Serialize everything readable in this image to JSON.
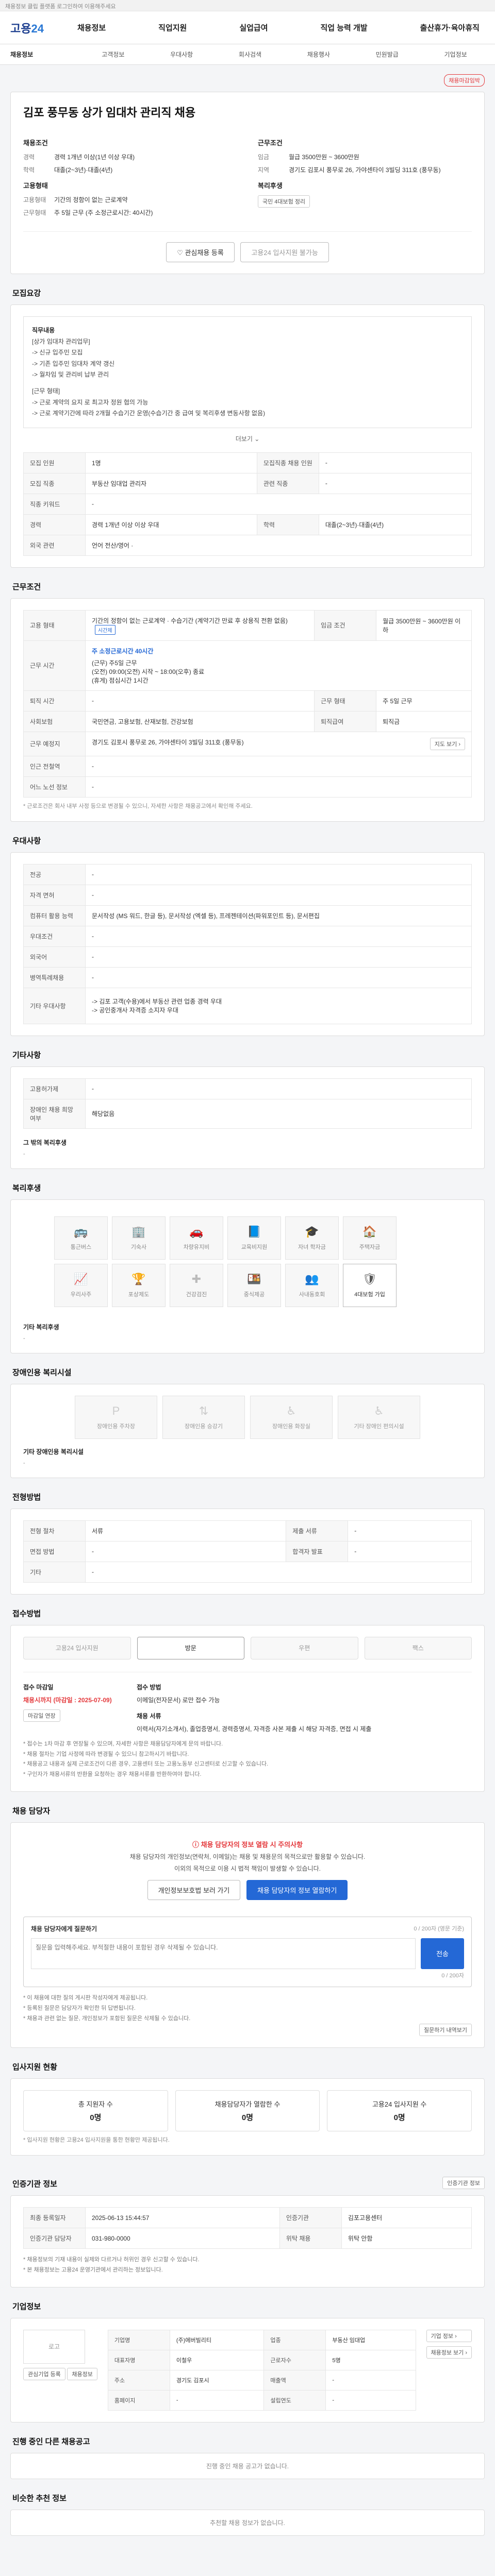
{
  "top_notice": "채용정보 클립 플랫폼 로그인하여 이용해주세요",
  "brand": {
    "name_main": "고용",
    "name_num": "24"
  },
  "gnb": [
    "채용정보",
    "직업지원",
    "실업급여",
    "직업 능력 개발",
    "출산휴가·육아휴직"
  ],
  "subnav": [
    "채용정보",
    "고객정보",
    "우대사항",
    "회사검색",
    "채용행사",
    "민원발급",
    "기업정보"
  ],
  "job": {
    "badge": "채용마감임박",
    "title": "김포 풍무동 상가 임대차 관리직 채용",
    "left_title": "채용조건",
    "left": [
      {
        "k": "경력",
        "v": "경력 1개년 이상(1년 이상 우대)"
      },
      {
        "k": "학력",
        "v": "대졸(2~3년)·대졸(4년)"
      }
    ],
    "right_title": "근무조건",
    "right": [
      {
        "k": "임금",
        "v": "월급 3500만원 ~ 3600만원"
      },
      {
        "k": "지역",
        "v": "경기도 김포시 풍무로 26, 가야센타이 3빌딩 311호 (풍무동)"
      }
    ],
    "left2_title": "고용형태",
    "left2": [
      {
        "k": "고용형태",
        "v": "기간의 정함이 없는 근로계약"
      },
      {
        "k": "근무형태",
        "v": "주 5일 근무 (주 소정근로시간: 40시간)"
      }
    ],
    "right2_title": "복리후생",
    "right2_badge": "국민 4대보험 정리",
    "btn_like": "관심채용 등록",
    "btn_share": "고용24 입사지원 불가능"
  },
  "summary": {
    "section": "모집요강",
    "box_title": "직무내용",
    "lines": [
      "[상가 임대차 관리업무]",
      "-> 신규 입주민 모집",
      "-> 기존 입주민 임대차 계약 갱신",
      "-> 월차임 및 관리비 납부 관리",
      "",
      "[근무 형태]",
      "-> 근로 계약의 요지 로 최고자 정원 협의 가능",
      "-> 근로 계약기간에 따라 2개월 수습기간 운영(수습기간 중 급여 및 복리후생 변동사항 없음)"
    ],
    "more": "더보기 ⌄"
  },
  "detail_table": [
    [
      "모집 인원",
      "1명",
      "모집직종 채용 인원",
      "-"
    ],
    [
      "모집 직종",
      "부동산 임대업 관리자",
      "관련 직종",
      "-"
    ],
    [
      "직종 키워드",
      "-",
      "",
      ""
    ],
    [
      "경력",
      "경력 1개년 이상 이상 우대",
      "학력",
      "대졸(2~3년)·대졸(4년)"
    ],
    [
      "외국 관련",
      "언어 전산/영어 ·",
      "",
      ""
    ]
  ],
  "conditions": {
    "section": "근무조건",
    "emp_type": "기간의 정함이 없는 근로계약 · 수습기간 (계약기간 만료 후 상용직 전환 없음)",
    "emp_tag": "시간제",
    "salary_label": "임금 조건",
    "salary": "월급 3500만원 ~ 3600만원 이하",
    "hours_label": "근무 시간",
    "hours_badge": "주 소정근로시간 40시간",
    "hours_lines": [
      "(근무) 주5일 근무",
      "(오전) 09:00(오전) 시작 ~ 18:00(오후) 종료",
      "(휴게) 점심시간 1시간"
    ],
    "rows": [
      [
        "퇴직 시간",
        "-",
        "근무 형태",
        "주 5일 근무"
      ],
      [
        "사회보험",
        "국민연금, 고용보험, 산재보험, 건강보험",
        "퇴직급여",
        "퇴직금"
      ],
      [
        "근무 예정지",
        "경기도 김포시 풍무로 26, 가야센타이 3빌딩 311호 (풍무동)",
        "",
        ""
      ],
      [
        "인근 전철역",
        "-",
        "",
        ""
      ],
      [
        "어느 노선 정보",
        "-",
        "",
        ""
      ]
    ],
    "map_btn": "지도 보기 ›",
    "note": "* 근로조건은 회사 내부 사정 등으로 변경될 수 있으니, 자세한 사항은 채용공고에서 확인해 주세요."
  },
  "preference": {
    "section": "우대사항",
    "rows": [
      [
        "전공",
        "-"
      ],
      [
        "자격 면허",
        "-"
      ],
      [
        "컴퓨터 활용 능력",
        "문서작성 (MS 워드, 한글 등), 문서작성 (엑셀 등), 프레젠테이션(파워포인트 등), 문서편집"
      ],
      [
        "우대조건",
        "-"
      ],
      [
        "외국어",
        "-"
      ],
      [
        "병역특례채용",
        "-"
      ],
      [
        "기타 우대사항",
        "-> 김포 고객(수용)에서 부동산 관련 업종 경력 우대\n-> 공인중개사 자격증 소지자 우대"
      ]
    ]
  },
  "other": {
    "section": "기타사항",
    "rows": [
      [
        "고용허가제",
        "-"
      ],
      [
        "장애인 채용 희망 여부",
        "해당없음"
      ]
    ],
    "etc_title": "그 밖의 복리후생",
    "etc_value": "-"
  },
  "welfare": {
    "section": "복리후생",
    "items": [
      {
        "icon": "▣",
        "label": "통근버스",
        "on": false
      },
      {
        "icon": "▣",
        "label": "기숙사",
        "on": false
      },
      {
        "icon": "▣",
        "label": "차량유지비",
        "on": false
      },
      {
        "icon": "▣",
        "label": "교육비지원",
        "on": false
      },
      {
        "icon": "▣",
        "label": "자녀 학자금",
        "on": false
      },
      {
        "icon": "▣",
        "label": "주택자금",
        "on": false
      },
      {
        "icon": "▣",
        "label": "우리사주",
        "on": false
      },
      {
        "icon": "▣",
        "label": "포상제도",
        "on": false
      },
      {
        "icon": "▣",
        "label": "건강검진",
        "on": false
      },
      {
        "icon": "▣",
        "label": "중식제공",
        "on": false
      },
      {
        "icon": "▣",
        "label": "사내동호회",
        "on": false
      },
      {
        "icon": "▣",
        "label": "4대보험 가입",
        "on": true
      }
    ],
    "etc_title": "기타 복리후생",
    "etc_value": "-"
  },
  "disability": {
    "section": "장애인용 복리시설",
    "items": [
      "장애인용 주차장",
      "장애인용 승강기",
      "장애인용 화장실",
      "기타 장애인 편의시설"
    ],
    "etc_title": "기타 장애인용 복리시설",
    "etc_value": "-"
  },
  "process": {
    "section": "전형방법",
    "rows": [
      [
        "전형 절차",
        "서류",
        "제출 서류",
        "-"
      ],
      [
        "면접 방법",
        "-",
        "합격자 발표",
        "-"
      ],
      [
        "기타",
        "-",
        "",
        ""
      ]
    ]
  },
  "apply": {
    "section": "접수방법",
    "methods": [
      {
        "label": "고용24 입사지원",
        "on": false
      },
      {
        "label": "방문",
        "on": true
      },
      {
        "label": "우편",
        "on": false
      },
      {
        "label": "팩스",
        "on": false
      }
    ],
    "deadline_label": "접수 마감일",
    "deadline": "채용시까지 (마감일 : 2025-07-09)",
    "deadline_btn": "마감일 연장",
    "method_label": "접수 방법",
    "method_value": "이메일(전자문서) 로만 접수 가능",
    "contact_label": "채용 서류",
    "contact_value": "이력서(자기소개서), 졸업증명서, 경력증명서, 자격증 사본 제출 시 해당 자격증, 면접 시 제출",
    "warnings": [
      "* 접수는 1차 마감 후 연장될 수 있으며, 자세한 사항은 채용담당자에게 문의 바랍니다.",
      "* 채용 절차는 기업 사정에 따라 변경될 수 있으니 참고하시기 바랍니다.",
      "* 채용공고 내용과 실제 근로조건이 다른 경우, 고용센터 또는 고용노동부 신고센터로 신고할 수 있습니다.",
      "* 구인자가 채용서류의 반환을 요청하는 경우 채용서류를 반환하여야 합니다."
    ]
  },
  "qna": {
    "section": "채용 담당자",
    "headline": "채용 담당자의 정보 열람 시 주의사항",
    "desc1": "채용 담당자의 개인정보(연락처, 이메일)는 채용 및 채용문의 목적으로만 활용할 수 있습니다.",
    "desc2": "이외의 목적으로 이용 시 법적 책임이 발생할 수 있습니다.",
    "btn_privacy": "개인정보보호법 보러 가기",
    "btn_view": "채용 담당자의 정보 열람하기",
    "box_title": "채용 담당자에게 질문하기",
    "box_right": "0 / 200자 (영문 기준)",
    "placeholder": "질문을 입력해주세요. 부적절한 내용이 포함된 경우 삭제될 수 있습니다.",
    "send": "전송",
    "counter": "0 / 200자",
    "notes": [
      "* 이 채용에 대한 질의 게시판 작성자에게 제공됩니다.",
      "* 등록된 질문은 담당자가 확인한 뒤 답변됩니다.",
      "* 채용과 관련 없는 질문, 개인정보가 포함된 질문은 삭제될 수 있습니다."
    ],
    "more_btn": "질문하기 내역보기"
  },
  "applicants": {
    "section": "입사지원 현황",
    "stats": [
      {
        "label": "총 지원자 수",
        "value": "0명"
      },
      {
        "label": "채용담당자가 열람한 수",
        "value": "0명"
      },
      {
        "label": "고용24 입사지원 수",
        "value": "0명"
      }
    ],
    "note": "* 입사지원 현황은 고용24 입사지원을 통한 현황만 제공됩니다."
  },
  "info": {
    "section": "인증기관 정보",
    "btn": "인증기관 정보",
    "rows": [
      [
        "최종 등록일자",
        "2025-06-13 15:44:57",
        "인증기관",
        "김포고용센터"
      ],
      [
        "인증기관 담당자",
        "031-980-0000",
        "위탁 채용",
        "위탁 안함"
      ]
    ],
    "notes": [
      "* 채용정보의 기재 내용이 실제와 다르거나 허위인 경우 신고할 수 있습니다.",
      "* 본 채용정보는 고용24 운영기관에서 관리하는 정보입니다."
    ]
  },
  "company": {
    "section": "기업정보",
    "logo": "로고",
    "btn1": "관심기업 등록",
    "btn2": "채용정보",
    "rows": [
      [
        "기업명",
        "(주)에버빌리티",
        "업종",
        "부동산 임대업"
      ],
      [
        "대표자명",
        "이철우",
        "근로자수",
        "5명"
      ],
      [
        "주소",
        "경기도 김포시",
        "매출액",
        "-"
      ],
      [
        "홈페이지",
        "-",
        "설립연도",
        "-"
      ]
    ],
    "right_btns": [
      "기업 정보 ›",
      "채용정보 보기 ›"
    ]
  },
  "other_jobs": {
    "section": "진행 중인 다른 채용공고",
    "empty": "진행 중인 채용 공고가 없습니다."
  },
  "recommend": {
    "section": "비슷한 추천 정보",
    "empty": "추천할 채용 정보가 없습니다."
  }
}
